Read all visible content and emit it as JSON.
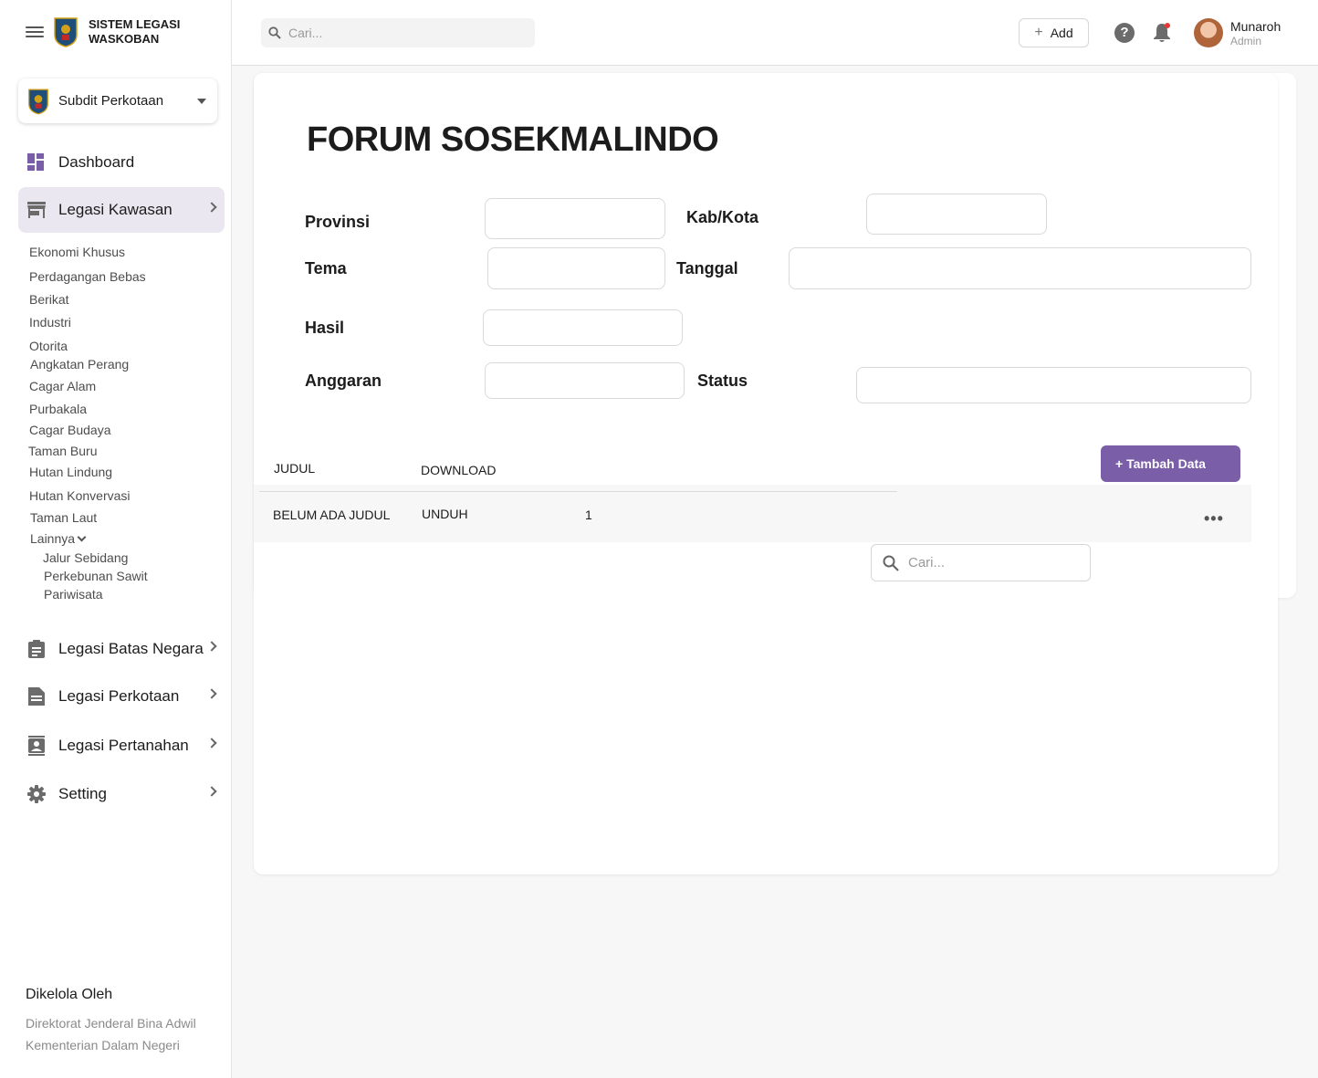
{
  "brand": {
    "line1": "SISTEM LEGASI",
    "line2": "WASKOBAN"
  },
  "unit_select": {
    "value": "Subdit Perkotaan"
  },
  "nav": {
    "dashboard": "Dashboard",
    "legasi_kawasan": "Legasi Kawasan",
    "legasi_batas_negara": "Legasi Batas Negara",
    "legasi_perkotaan": "Legasi Perkotaan",
    "legasi_pertanahan": "Legasi Pertanahan",
    "setting": "Setting"
  },
  "submenu": {
    "items": [
      "Ekonomi Khusus",
      "Perdagangan Bebas",
      "Berikat",
      "Industri",
      "Otorita",
      "Angkatan Perang",
      "Cagar Alam",
      "Purbakala",
      "Cagar Budaya",
      "Taman Buru",
      "Hutan Lindung",
      "Hutan Konvervasi",
      "Taman Laut"
    ],
    "lainnya": "Lainnya",
    "lainnya_items": [
      "Jalur Sebidang",
      "Perkebunan Sawit",
      "Pariwisata"
    ]
  },
  "footer": {
    "title": "Dikelola Oleh",
    "line1": "Direktorat Jenderal Bina Adwil",
    "line2": "Kementerian Dalam Negeri"
  },
  "topbar": {
    "search_placeholder": "Cari...",
    "add_label": "Add",
    "user_name": "Munaroh",
    "user_role": "Admin"
  },
  "page": {
    "title": "FORUM SOSEKMALINDO",
    "fields": {
      "provinsi": {
        "label": "Provinsi",
        "value": ""
      },
      "kab_kota": {
        "label": "Kab/Kota",
        "value": ""
      },
      "tema": {
        "label": "Tema",
        "value": ""
      },
      "tanggal": {
        "label": "Tanggal",
        "value": ""
      },
      "hasil": {
        "label": "Hasil",
        "value": ""
      },
      "anggaran": {
        "label": "Anggaran",
        "value": ""
      },
      "status": {
        "label": "Status",
        "value": ""
      }
    },
    "table": {
      "headers": {
        "judul": "JUDUL",
        "download": "DOWNLOAD"
      },
      "tambah_label": "+ Tambah Data",
      "rows": [
        {
          "judul": "BELUM ADA JUDUL",
          "download": "UNDUH",
          "count": "1"
        }
      ],
      "more_label": "•••",
      "search_placeholder": "Cari..."
    }
  },
  "colors": {
    "accent": "#7b5ea8",
    "active_nav_bg": "#ebe7f0",
    "notification_dot": "#e53935"
  }
}
